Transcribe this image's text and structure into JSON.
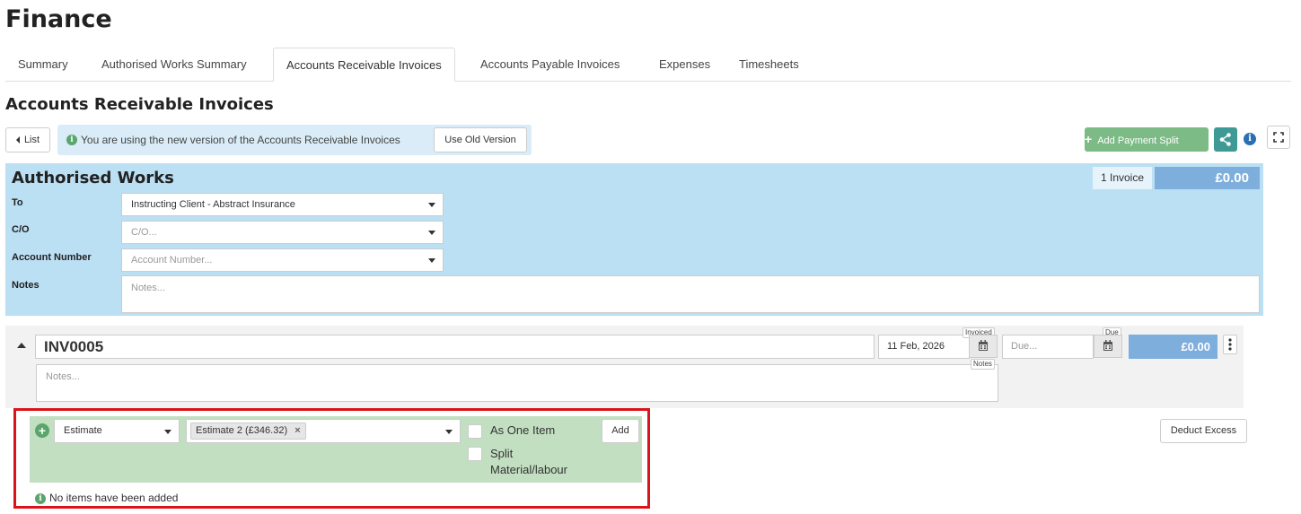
{
  "page_title": "Finance",
  "tabs": [
    {
      "label": "Summary",
      "active": false
    },
    {
      "label": "Authorised Works Summary",
      "active": false
    },
    {
      "label": "Accounts Receivable Invoices",
      "active": true
    },
    {
      "label": "Accounts Payable Invoices",
      "active": false
    },
    {
      "label": "Expenses",
      "active": false
    },
    {
      "label": "Timesheets",
      "active": false
    }
  ],
  "section_title": "Accounts Receivable Invoices",
  "toolbar": {
    "list_label": "List",
    "info_text": "You are using the new version of the Accounts Receivable Invoices",
    "use_old_version_label": "Use Old Version",
    "add_payment_split_label": "Add Payment Split"
  },
  "authorised_works": {
    "title": "Authorised Works",
    "invoice_count": "1 Invoice",
    "total": "£0.00",
    "to_label": "To",
    "to_value": "Instructing Client - Abstract Insurance",
    "co_label": "C/O",
    "co_placeholder": "C/O...",
    "account_number_label": "Account Number",
    "account_number_placeholder": "Account Number...",
    "notes_label": "Notes",
    "notes_placeholder": "Notes..."
  },
  "invoice": {
    "number": "INV0005",
    "invoiced_date": "11 Feb, 2026",
    "invoiced_tag": "Invoiced",
    "due_placeholder": "Due...",
    "due_tag": "Due",
    "amount": "£0.00",
    "notes_placeholder": "Notes...",
    "notes_tag": "Notes"
  },
  "add_items": {
    "type_value": "Estimate",
    "selected_chip": "Estimate 2 (£346.32)",
    "as_one_item_label": "As One Item",
    "split_label_line1": "Split",
    "split_label_line2": "Material/labour",
    "add_label": "Add",
    "deduct_excess_label": "Deduct Excess",
    "empty_message": "No items have been added"
  },
  "colors": {
    "works_panel": "#bbdff3",
    "green_action": "#7cbb85",
    "amount_blue": "#7eaedc",
    "highlight_red": "#d9141b",
    "item_panel_green": "#c2dfc1"
  }
}
